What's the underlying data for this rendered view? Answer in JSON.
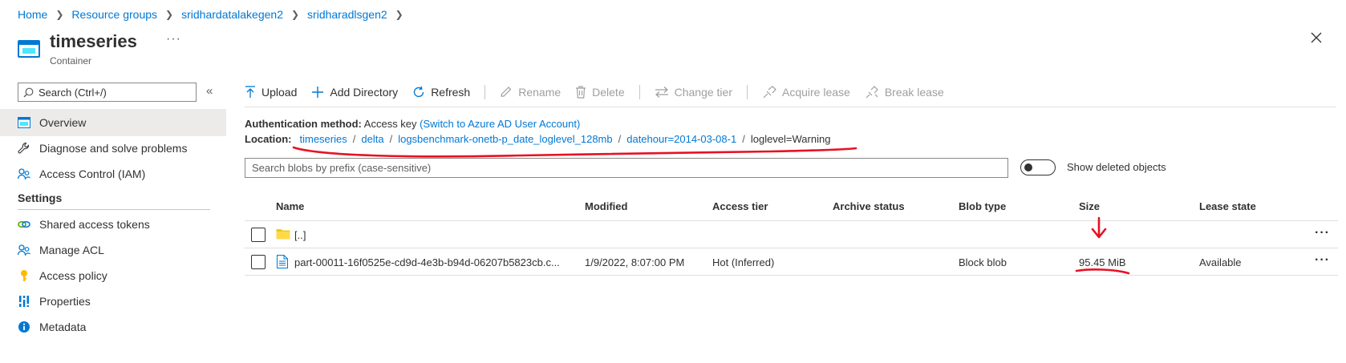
{
  "breadcrumb": [
    "Home",
    "Resource groups",
    "sridhardatalakegen2",
    "sridharadlsgen2"
  ],
  "header": {
    "title": "timeseries",
    "subtitle": "Container",
    "more": "···"
  },
  "sidebar": {
    "search_placeholder": "Search (Ctrl+/)",
    "collapse": "«",
    "items": [
      {
        "label": "Overview",
        "icon": "overview-icon"
      },
      {
        "label": "Diagnose and solve problems",
        "icon": "wrench-icon"
      },
      {
        "label": "Access Control (IAM)",
        "icon": "people-icon"
      }
    ],
    "settings_heading": "Settings",
    "settings_items": [
      {
        "label": "Shared access tokens",
        "icon": "link-icon"
      },
      {
        "label": "Manage ACL",
        "icon": "people-icon"
      },
      {
        "label": "Access policy",
        "icon": "key-icon"
      },
      {
        "label": "Properties",
        "icon": "properties-icon"
      },
      {
        "label": "Metadata",
        "icon": "info-icon"
      }
    ]
  },
  "toolbar": {
    "upload": "Upload",
    "add_directory": "Add Directory",
    "refresh": "Refresh",
    "rename": "Rename",
    "delete": "Delete",
    "change_tier": "Change tier",
    "acquire_lease": "Acquire lease",
    "break_lease": "Break lease"
  },
  "auth": {
    "label": "Authentication method:",
    "value": "Access key",
    "switch_link": "(Switch to Azure AD User Account)"
  },
  "location": {
    "label": "Location:",
    "segments": [
      "timeseries",
      "delta",
      "logsbenchmark-onetb-p_date_loglevel_128mb",
      "datehour=2014-03-08-1"
    ],
    "current": "loglevel=Warning"
  },
  "blob_search": {
    "placeholder": "Search blobs by prefix (case-sensitive)"
  },
  "show_deleted": {
    "label": "Show deleted objects",
    "on": false
  },
  "table": {
    "columns": [
      "Name",
      "Modified",
      "Access tier",
      "Archive status",
      "Blob type",
      "Size",
      "Lease state"
    ],
    "rows": [
      {
        "name": "[..]",
        "modified": "",
        "access_tier": "",
        "archive_status": "",
        "blob_type": "",
        "size": "",
        "lease_state": "",
        "icon": "folder-icon"
      },
      {
        "name": "part-00011-16f0525e-cd9d-4e3b-b94d-06207b5823cb.c...",
        "modified": "1/9/2022, 8:07:00 PM",
        "access_tier": "Hot (Inferred)",
        "archive_status": "",
        "blob_type": "Block blob",
        "size": "95.45 MiB",
        "lease_state": "Available",
        "icon": "file-icon"
      }
    ],
    "more": "···"
  },
  "colors": {
    "link": "#0078d4",
    "annotation": "#e81123",
    "folder": "#f2c811"
  }
}
